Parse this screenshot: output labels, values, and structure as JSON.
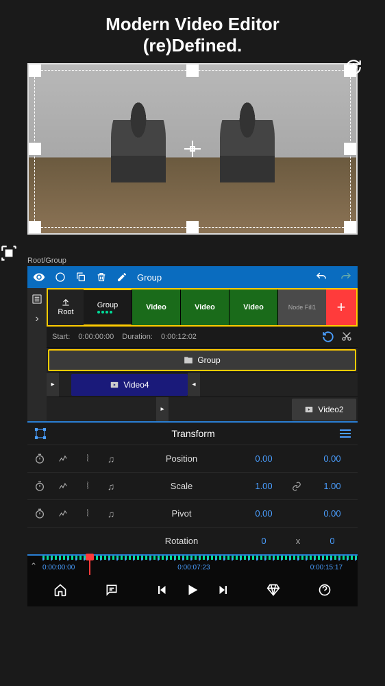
{
  "header": {
    "line1": "Modern Video Editor",
    "line2": "(re)Defined."
  },
  "breadcrumb": "Root/Group",
  "toolbar": {
    "group_label": "Group"
  },
  "tabs": {
    "root_label": "Root",
    "group_label": "Group",
    "items": [
      {
        "label": "Video",
        "type": "green"
      },
      {
        "label": "Video",
        "type": "green"
      },
      {
        "label": "Video",
        "type": "green"
      },
      {
        "label": "Node Fill1",
        "type": "gray"
      }
    ]
  },
  "timeline_info": {
    "start_label": "Start:",
    "start_value": "0:00:00:00",
    "duration_label": "Duration:",
    "duration_value": "0:00:12:02"
  },
  "clips": {
    "group": "Group",
    "video4": "Video4",
    "video2": "Video2"
  },
  "transform": {
    "title": "Transform",
    "rows": [
      {
        "label": "Position",
        "v1": "0.00",
        "link": "",
        "v2": "0.00"
      },
      {
        "label": "Scale",
        "v1": "1.00",
        "link": "link",
        "v2": "1.00"
      },
      {
        "label": "Pivot",
        "v1": "0.00",
        "link": "",
        "v2": "0.00"
      },
      {
        "label": "Rotation",
        "v1": "0",
        "link": "x",
        "v2": "0"
      }
    ]
  },
  "ruler": {
    "t1": "0:00:00:00",
    "t2": "0:00:07:23",
    "t3": "0:00:15:17"
  }
}
